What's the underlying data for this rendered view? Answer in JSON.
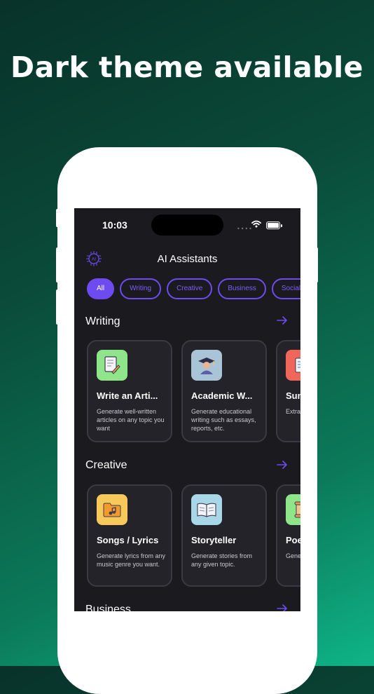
{
  "headline": "Dark theme available",
  "status_bar": {
    "time": "10:03",
    "signal_icon": "signal-dots-icon",
    "wifi_icon": "wifi-icon",
    "battery_icon": "battery-icon"
  },
  "header": {
    "title": "AI Assistants",
    "logo_icon": "ai-chip-icon",
    "logo_text": "AI"
  },
  "chips": [
    {
      "label": "All",
      "active": true
    },
    {
      "label": "Writing",
      "active": false
    },
    {
      "label": "Creative",
      "active": false
    },
    {
      "label": "Business",
      "active": false
    },
    {
      "label": "Social",
      "active": false
    }
  ],
  "sections": [
    {
      "title": "Writing",
      "arrow_icon": "arrow-right-icon",
      "cards": [
        {
          "title": "Write an Arti...",
          "desc": "Generate well-written articles on any topic you want",
          "icon": "document-pencil-icon",
          "color": "#8ee58a"
        },
        {
          "title": "Academic W...",
          "desc": "Generate educational writing such as essays, reports, etc.",
          "icon": "graduate-icon",
          "color": "#a8c4d6"
        },
        {
          "title": "Sum",
          "desc": "Extra from",
          "icon": "summary-icon",
          "color": "#f0665a"
        }
      ]
    },
    {
      "title": "Creative",
      "arrow_icon": "arrow-right-icon",
      "cards": [
        {
          "title": "Songs / Lyrics",
          "desc": "Generate lyrics from any music genre you want.",
          "icon": "music-folder-icon",
          "color": "#f7c85a"
        },
        {
          "title": "Storyteller",
          "desc": "Generate stories from any given topic.",
          "icon": "open-book-icon",
          "color": "#a8d8e8"
        },
        {
          "title": "Poe",
          "desc": "Gene diffe",
          "icon": "scroll-icon",
          "color": "#8ee58a"
        }
      ]
    },
    {
      "title": "Business",
      "arrow_icon": "arrow-right-icon"
    }
  ],
  "colors": {
    "accent": "#6c4bf0",
    "screen_bg": "#1b1b1f",
    "card_bg": "#232329"
  }
}
